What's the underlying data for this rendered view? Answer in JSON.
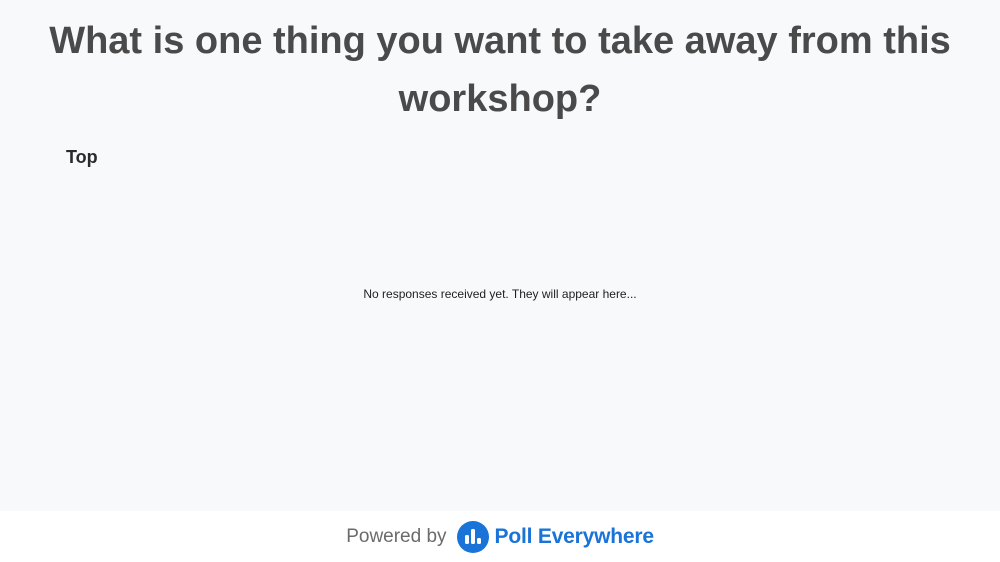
{
  "poll": {
    "question": "What is one thing you want to take away from this workshop?",
    "sort_label": "Top",
    "empty_message": "No responses received yet. They will appear here..."
  },
  "footer": {
    "powered_by": "Powered by",
    "brand_name": "Poll Everywhere",
    "brand_icon": "poll-everywhere-logo-icon",
    "brand_color": "#1a73d9"
  },
  "colors": {
    "background": "#f8f9fb",
    "title": "#4a4a4a",
    "footer_background": "#ffffff"
  }
}
